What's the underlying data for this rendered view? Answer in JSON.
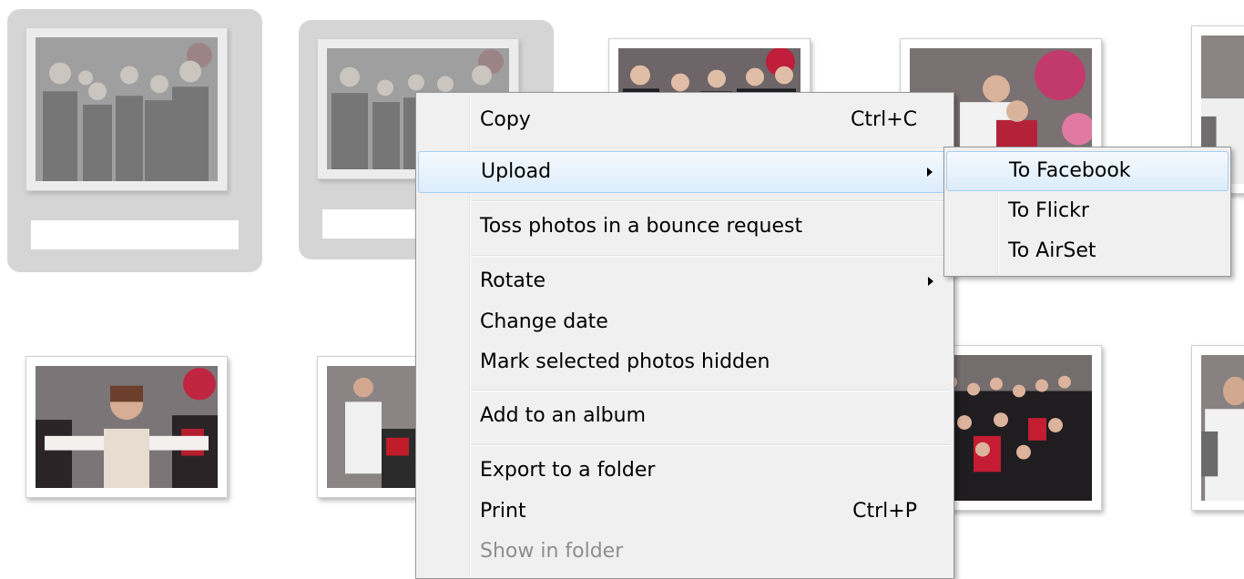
{
  "thumbnails": [
    {
      "id": "t1",
      "selected": true
    },
    {
      "id": "t2",
      "selected": true
    },
    {
      "id": "t3",
      "selected": false
    },
    {
      "id": "t4",
      "selected": false
    },
    {
      "id": "t5",
      "selected": false
    },
    {
      "id": "t6",
      "selected": false
    },
    {
      "id": "t7",
      "selected": false
    },
    {
      "id": "t8",
      "selected": false
    },
    {
      "id": "t9",
      "selected": false
    }
  ],
  "context_menu": {
    "copy": {
      "label": "Copy",
      "shortcut": "Ctrl+C"
    },
    "upload": {
      "label": "Upload",
      "highlighted": true
    },
    "toss": {
      "label": "Toss photos in a bounce request"
    },
    "rotate": {
      "label": "Rotate"
    },
    "change_date": {
      "label": "Change date"
    },
    "mark_hidden": {
      "label": "Mark selected photos hidden"
    },
    "add_album": {
      "label": "Add to an album"
    },
    "export": {
      "label": "Export to a folder"
    },
    "print": {
      "label": "Print",
      "shortcut": "Ctrl+P"
    },
    "show_folder": {
      "label": "Show in folder",
      "disabled": true
    }
  },
  "submenu": {
    "facebook": {
      "label": "To Facebook",
      "highlighted": true
    },
    "flickr": {
      "label": "To Flickr"
    },
    "airset": {
      "label": "To AirSet"
    }
  },
  "colors": {
    "selection_bg": "#d5d5d5",
    "menu_bg": "#f0f0f0",
    "highlight_border": "#a8cdf0",
    "disabled_text": "#8e8e8e"
  }
}
